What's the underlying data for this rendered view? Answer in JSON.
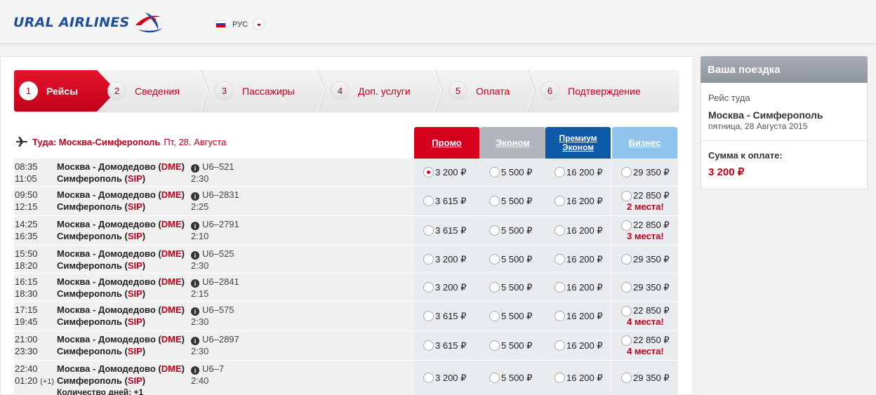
{
  "header": {
    "logo_text": "URAL AIRLINES",
    "language": "РУС",
    "brand_colors": {
      "red": "#d6001c",
      "blue": "#1f4e98"
    }
  },
  "steps": [
    {
      "num": "1",
      "label": "Рейсы",
      "active": true
    },
    {
      "num": "2",
      "label": "Сведения"
    },
    {
      "num": "3",
      "label": "Пассажиры"
    },
    {
      "num": "4",
      "label": "Доп. услуги"
    },
    {
      "num": "5",
      "label": "Оплата"
    },
    {
      "num": "6",
      "label": "Подтверждение"
    }
  ],
  "route": {
    "label": "Туда: Москва-Симферополь",
    "date": "Пт, 28. Августа"
  },
  "fare_headers": {
    "promo": "Промо",
    "econom": "Эконом",
    "premium_line1": "Премиум",
    "premium_line2": "Эконом",
    "business": "Бизнес"
  },
  "flights": [
    {
      "dep": "08:35",
      "arr": "11:05",
      "from": "Москва - Домодедово",
      "from_code": "DME",
      "to": "Симферополь",
      "to_code": "SIP",
      "flight": "U6–521",
      "duration": "2:30",
      "promo": "3 200 ₽",
      "econom": "5 500 ₽",
      "premium": "16 200 ₽",
      "business": "29 350 ₽",
      "seats": "",
      "selected": true
    },
    {
      "dep": "09:50",
      "arr": "12:15",
      "from": "Москва - Домодедово",
      "from_code": "DME",
      "to": "Симферополь",
      "to_code": "SIP",
      "flight": "U6–2831",
      "duration": "2:25",
      "promo": "3 615 ₽",
      "econom": "5 500 ₽",
      "premium": "16 200 ₽",
      "business": "22 850 ₽",
      "seats": "2 места!"
    },
    {
      "dep": "14:25",
      "arr": "16:35",
      "from": "Москва - Домодедово",
      "from_code": "DME",
      "to": "Симферополь",
      "to_code": "SIP",
      "flight": "U6–2791",
      "duration": "2:10",
      "promo": "3 615 ₽",
      "econom": "5 500 ₽",
      "premium": "16 200 ₽",
      "business": "22 850 ₽",
      "seats": "3 места!"
    },
    {
      "dep": "15:50",
      "arr": "18:20",
      "from": "Москва - Домодедово",
      "from_code": "DME",
      "to": "Симферополь",
      "to_code": "SIP",
      "flight": "U6–525",
      "duration": "2:30",
      "promo": "3 200 ₽",
      "econom": "5 500 ₽",
      "premium": "16 200 ₽",
      "business": "29 350 ₽",
      "seats": ""
    },
    {
      "dep": "16:15",
      "arr": "18:30",
      "from": "Москва - Домодедово",
      "from_code": "DME",
      "to": "Симферополь",
      "to_code": "SIP",
      "flight": "U6–2841",
      "duration": "2:15",
      "promo": "3 200 ₽",
      "econom": "5 500 ₽",
      "premium": "16 200 ₽",
      "business": "29 350 ₽",
      "seats": ""
    },
    {
      "dep": "17:15",
      "arr": "19:45",
      "from": "Москва - Домодедово",
      "from_code": "DME",
      "to": "Симферополь",
      "to_code": "SIP",
      "flight": "U6–575",
      "duration": "2:30",
      "promo": "3 615 ₽",
      "econom": "5 500 ₽",
      "premium": "16 200 ₽",
      "business": "22 850 ₽",
      "seats": "4 места!"
    },
    {
      "dep": "21:00",
      "arr": "23:30",
      "from": "Москва - Домодедово",
      "from_code": "DME",
      "to": "Симферополь",
      "to_code": "SIP",
      "flight": "U6–2897",
      "duration": "2:30",
      "promo": "3 615 ₽",
      "econom": "5 500 ₽",
      "premium": "16 200 ₽",
      "business": "22 850 ₽",
      "seats": "4 места!"
    },
    {
      "dep": "22:40",
      "arr": "01:20",
      "arr_plus": "(+1)",
      "from": "Москва - Домодедово",
      "from_code": "DME",
      "to": "Симферополь",
      "to_code": "SIP",
      "flight": "U6–7",
      "duration": "2:40",
      "days_note": "Количество дней: +1",
      "promo": "3 200 ₽",
      "econom": "5 500 ₽",
      "premium": "16 200 ₽",
      "business": "29 350 ₽",
      "seats": ""
    }
  ],
  "sidebar": {
    "title": "Ваша поездка",
    "direction_label": "Рейс туда",
    "route": "Москва - Симферополь",
    "date": "пятница, 28 Августа 2015",
    "total_label": "Сумма к оплате:",
    "total": "3 200 ₽"
  }
}
